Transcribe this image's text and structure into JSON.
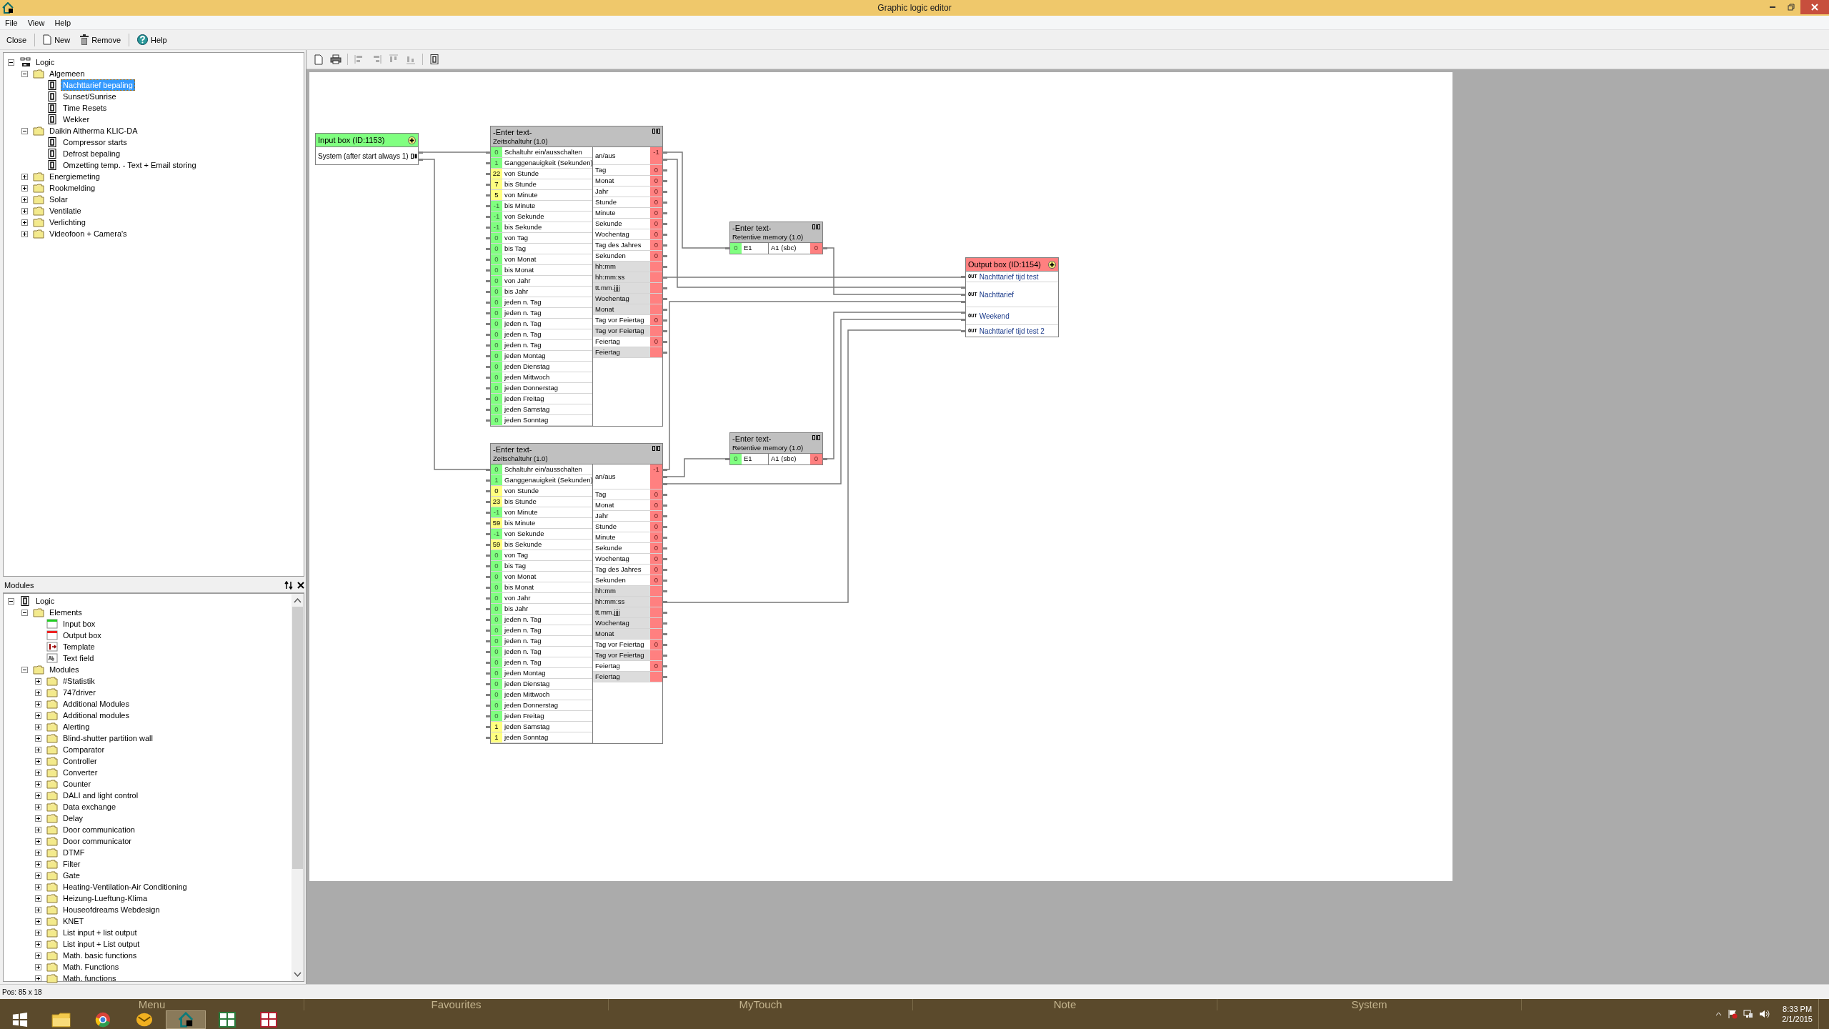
{
  "window": {
    "title": "Graphic logic editor"
  },
  "menu": [
    "File",
    "View",
    "Help"
  ],
  "toolbar": [
    {
      "label": "Close",
      "kind": "plain"
    },
    {
      "label": "New",
      "kind": "new"
    },
    {
      "label": "Remove",
      "kind": "trash"
    },
    {
      "label": "Help",
      "kind": "help"
    }
  ],
  "project_tree": [
    {
      "label": "Logic",
      "kind": "root",
      "expanded": true,
      "selected": false,
      "children": [
        {
          "label": "Algemeen",
          "kind": "folder",
          "expanded": true,
          "selected": false,
          "children": [
            {
              "label": "Nachttarief bepaling",
              "kind": "logic",
              "selected": true
            },
            {
              "label": "Sunset/Sunrise",
              "kind": "logic",
              "selected": false
            },
            {
              "label": "Time Resets",
              "kind": "logic",
              "selected": false
            },
            {
              "label": "Wekker",
              "kind": "logic",
              "selected": false
            }
          ]
        },
        {
          "label": "Daikin Altherma KLIC-DA",
          "kind": "folder",
          "expanded": true,
          "selected": false,
          "children": [
            {
              "label": "Compressor starts",
              "kind": "logic",
              "selected": false
            },
            {
              "label": "Defrost bepaling",
              "kind": "logic",
              "selected": false
            },
            {
              "label": "Omzetting temp. - Text + Email storing",
              "kind": "logic",
              "selected": false
            }
          ]
        },
        {
          "label": "Energiemeting",
          "kind": "folder",
          "expanded": false,
          "selected": false
        },
        {
          "label": "Rookmelding",
          "kind": "folder",
          "expanded": false,
          "selected": false
        },
        {
          "label": "Solar",
          "kind": "folder",
          "expanded": false,
          "selected": false
        },
        {
          "label": "Ventilatie",
          "kind": "folder",
          "expanded": false,
          "selected": false
        },
        {
          "label": "Verlichting",
          "kind": "folder",
          "expanded": false,
          "selected": false
        },
        {
          "label": "Videofoon + Camera's",
          "kind": "folder",
          "expanded": false,
          "selected": false
        }
      ]
    }
  ],
  "modules_panel": {
    "title": "Modules",
    "tree": [
      {
        "label": "Logic",
        "kind": "logic",
        "expanded": true,
        "selected": false,
        "children": [
          {
            "label": "Elements",
            "kind": "folder",
            "expanded": true,
            "selected": false,
            "children": [
              {
                "label": "Input box",
                "kind": "input",
                "selected": false
              },
              {
                "label": "Output box",
                "kind": "output",
                "selected": false
              },
              {
                "label": "Template",
                "kind": "template",
                "selected": false
              },
              {
                "label": "Text field",
                "kind": "textfield",
                "selected": false
              }
            ]
          },
          {
            "label": "Modules",
            "kind": "folder",
            "expanded": true,
            "selected": false,
            "children": [
              {
                "label": "#Statistik",
                "kind": "folder",
                "expanded": false,
                "selected": false
              },
              {
                "label": "747driver",
                "kind": "folder",
                "expanded": false,
                "selected": false
              },
              {
                "label": "Additional Modules",
                "kind": "folder",
                "expanded": false,
                "selected": false
              },
              {
                "label": "Additional modules",
                "kind": "folder",
                "expanded": false,
                "selected": false
              },
              {
                "label": "Alerting",
                "kind": "folder",
                "expanded": false,
                "selected": false
              },
              {
                "label": "Blind-shutter partition wall",
                "kind": "folder",
                "expanded": false,
                "selected": false
              },
              {
                "label": "Comparator",
                "kind": "folder",
                "expanded": false,
                "selected": false
              },
              {
                "label": "Controller",
                "kind": "folder",
                "expanded": false,
                "selected": false
              },
              {
                "label": "Converter",
                "kind": "folder",
                "expanded": false,
                "selected": false
              },
              {
                "label": "Counter",
                "kind": "folder",
                "expanded": false,
                "selected": false
              },
              {
                "label": "DALI and light control",
                "kind": "folder",
                "expanded": false,
                "selected": false
              },
              {
                "label": "Data exchange",
                "kind": "folder",
                "expanded": false,
                "selected": false
              },
              {
                "label": "Delay",
                "kind": "folder",
                "expanded": false,
                "selected": false
              },
              {
                "label": "Door communication",
                "kind": "folder",
                "expanded": false,
                "selected": false
              },
              {
                "label": "Door communicator",
                "kind": "folder",
                "expanded": false,
                "selected": false
              },
              {
                "label": "DTMF",
                "kind": "folder",
                "expanded": false,
                "selected": false
              },
              {
                "label": "Filter",
                "kind": "folder",
                "expanded": false,
                "selected": false
              },
              {
                "label": "Gate",
                "kind": "folder",
                "expanded": false,
                "selected": false
              },
              {
                "label": "Heating-Ventilation-Air Conditioning",
                "kind": "folder",
                "expanded": false,
                "selected": false
              },
              {
                "label": "Heizung-Lueftung-Klima",
                "kind": "folder",
                "expanded": false,
                "selected": false
              },
              {
                "label": "Houseofdreams Webdesign",
                "kind": "folder",
                "expanded": false,
                "selected": false
              },
              {
                "label": "KNET",
                "kind": "folder",
                "expanded": false,
                "selected": false
              },
              {
                "label": "List input + list output",
                "kind": "folder",
                "expanded": false,
                "selected": false
              },
              {
                "label": "List input + List output",
                "kind": "folder",
                "expanded": false,
                "selected": false
              },
              {
                "label": "Math. basic functions",
                "kind": "folder",
                "expanded": false,
                "selected": false
              },
              {
                "label": "Math. Functions",
                "kind": "folder",
                "expanded": false,
                "selected": false
              },
              {
                "label": "Math. functions",
                "kind": "folder",
                "expanded": false,
                "selected": false
              }
            ]
          }
        ]
      }
    ]
  },
  "canvas_toolbar": [
    {
      "kind": "new",
      "disabled": false
    },
    {
      "kind": "print",
      "disabled": false
    },
    {
      "kind": "align-left",
      "disabled": true
    },
    {
      "kind": "align-right",
      "disabled": true
    },
    {
      "kind": "align-top",
      "disabled": true
    },
    {
      "kind": "align-bottom",
      "disabled": true
    },
    {
      "kind": "module",
      "disabled": false
    }
  ],
  "canvas": {
    "nodes": [
      {
        "kind": "input",
        "title": "Input box (ID:1153)",
        "rows": [
          {
            "label": "System (after start always 1)"
          }
        ]
      },
      {
        "kind": "timer",
        "title": "-Enter text-",
        "subtitle": "Zeitschaltuhr (1.0)",
        "inputs": [
          {
            "value": "0",
            "port": "Schaltuhr ein/ausschalten",
            "set": false
          },
          {
            "value": "1",
            "port": "Ganggenauigkeit (Sekunden)",
            "set": false
          },
          {
            "value": "22",
            "port": "von Stunde",
            "set": true
          },
          {
            "value": "7",
            "port": "bis Stunde",
            "set": true
          },
          {
            "value": "5",
            "port": "von Minute",
            "set": true
          },
          {
            "value": "-1",
            "port": "bis Minute",
            "set": false
          },
          {
            "value": "-1",
            "port": "von Sekunde",
            "set": false
          },
          {
            "value": "-1",
            "port": "bis Sekunde",
            "set": false
          },
          {
            "value": "0",
            "port": "von Tag",
            "set": false
          },
          {
            "value": "0",
            "port": "bis Tag",
            "set": false
          },
          {
            "value": "0",
            "port": "von Monat",
            "set": false
          },
          {
            "value": "0",
            "port": "bis Monat",
            "set": false
          },
          {
            "value": "0",
            "port": "von Jahr",
            "set": false
          },
          {
            "value": "0",
            "port": "bis Jahr",
            "set": false
          },
          {
            "value": "0",
            "port": "jeden n. Tag",
            "set": false
          },
          {
            "value": "0",
            "port": "jeden n. Tag",
            "set": false
          },
          {
            "value": "0",
            "port": "jeden n. Tag",
            "set": false
          },
          {
            "value": "0",
            "port": "jeden n. Tag",
            "set": false
          },
          {
            "value": "0",
            "port": "jeden n. Tag",
            "set": false
          },
          {
            "value": "0",
            "port": "jeden Montag",
            "set": false
          },
          {
            "value": "0",
            "port": "jeden Dienstag",
            "set": false
          },
          {
            "value": "0",
            "port": "jeden Mittwoch",
            "set": false
          },
          {
            "value": "0",
            "port": "jeden Donnerstag",
            "set": false
          },
          {
            "value": "0",
            "port": "jeden Freitag",
            "set": false
          },
          {
            "value": "0",
            "port": "jeden Samstag",
            "set": false
          },
          {
            "value": "0",
            "port": "jeden Sonntag",
            "set": false
          }
        ],
        "outputs": [
          {
            "kind": "primary",
            "label": "an/aus",
            "value": "-1"
          },
          {
            "kind": "number",
            "label": "Tag",
            "value": "0"
          },
          {
            "kind": "number",
            "label": "Monat",
            "value": "0"
          },
          {
            "kind": "number",
            "label": "Jahr",
            "value": "0"
          },
          {
            "kind": "number",
            "label": "Stunde",
            "value": "0"
          },
          {
            "kind": "number",
            "label": "Minute",
            "value": "0"
          },
          {
            "kind": "number",
            "label": "Sekunde",
            "value": "0"
          },
          {
            "kind": "number",
            "label": "Wochentag",
            "value": "0"
          },
          {
            "kind": "number",
            "label": "Tag des Jahres",
            "value": "0"
          },
          {
            "kind": "number",
            "label": "Sekunden",
            "value": "0"
          },
          {
            "kind": "text",
            "label": "hh:mm"
          },
          {
            "kind": "text",
            "label": "hh:mm:ss"
          },
          {
            "kind": "text",
            "label": "tt.mm.jjjj"
          },
          {
            "kind": "text",
            "label": "Wochentag"
          },
          {
            "kind": "text",
            "label": "Monat"
          },
          {
            "kind": "number",
            "label": "Tag vor Feiertag",
            "value": "0"
          },
          {
            "kind": "text",
            "label": "Tag vor Feiertag"
          },
          {
            "kind": "number",
            "label": "Feiertag",
            "value": "0"
          },
          {
            "kind": "text",
            "label": "Feiertag"
          }
        ]
      },
      {
        "kind": "memory",
        "title": "-Enter text-",
        "subtitle": "Retentive memory (1.0)",
        "input": {
          "value": "0",
          "port": "E1"
        },
        "output": {
          "label": "A1 (sbc)",
          "value": "0"
        }
      },
      {
        "kind": "output",
        "title": "Output box (ID:1154)",
        "rows": [
          {
            "tag": "OUT",
            "label": "Nachttarief tijd test"
          },
          {
            "tag": "OUT",
            "label": "Nachttarief"
          },
          {
            "tag": "OUT",
            "label": "Weekend"
          },
          {
            "tag": "OUT",
            "label": "Nachttarief tijd test 2"
          }
        ]
      },
      {
        "kind": "timer",
        "title": "-Enter text-",
        "subtitle": "Zeitschaltuhr (1.0)",
        "inputs": [
          {
            "value": "0",
            "port": "Schaltuhr ein/ausschalten",
            "set": false
          },
          {
            "value": "1",
            "port": "Ganggenauigkeit (Sekunden)",
            "set": false
          },
          {
            "value": "0",
            "port": "von Stunde",
            "set": true
          },
          {
            "value": "23",
            "port": "bis Stunde",
            "set": true
          },
          {
            "value": "-1",
            "port": "von Minute",
            "set": false
          },
          {
            "value": "59",
            "port": "bis Minute",
            "set": true
          },
          {
            "value": "-1",
            "port": "von Sekunde",
            "set": false
          },
          {
            "value": "59",
            "port": "bis Sekunde",
            "set": true
          },
          {
            "value": "0",
            "port": "von Tag",
            "set": false
          },
          {
            "value": "0",
            "port": "bis Tag",
            "set": false
          },
          {
            "value": "0",
            "port": "von Monat",
            "set": false
          },
          {
            "value": "0",
            "port": "bis Monat",
            "set": false
          },
          {
            "value": "0",
            "port": "von Jahr",
            "set": false
          },
          {
            "value": "0",
            "port": "bis Jahr",
            "set": false
          },
          {
            "value": "0",
            "port": "jeden n. Tag",
            "set": false
          },
          {
            "value": "0",
            "port": "jeden n. Tag",
            "set": false
          },
          {
            "value": "0",
            "port": "jeden n. Tag",
            "set": false
          },
          {
            "value": "0",
            "port": "jeden n. Tag",
            "set": false
          },
          {
            "value": "0",
            "port": "jeden n. Tag",
            "set": false
          },
          {
            "value": "0",
            "port": "jeden Montag",
            "set": false
          },
          {
            "value": "0",
            "port": "jeden Dienstag",
            "set": false
          },
          {
            "value": "0",
            "port": "jeden Mittwoch",
            "set": false
          },
          {
            "value": "0",
            "port": "jeden Donnerstag",
            "set": false
          },
          {
            "value": "0",
            "port": "jeden Freitag",
            "set": false
          },
          {
            "value": "1",
            "port": "jeden Samstag",
            "set": true
          },
          {
            "value": "1",
            "port": "jeden Sonntag",
            "set": true
          }
        ],
        "outputs": [
          {
            "kind": "primary",
            "label": "an/aus",
            "value": "-1"
          },
          {
            "kind": "number",
            "label": "Tag",
            "value": "0"
          },
          {
            "kind": "number",
            "label": "Monat",
            "value": "0"
          },
          {
            "kind": "number",
            "label": "Jahr",
            "value": "0"
          },
          {
            "kind": "number",
            "label": "Stunde",
            "value": "0"
          },
          {
            "kind": "number",
            "label": "Minute",
            "value": "0"
          },
          {
            "kind": "number",
            "label": "Sekunde",
            "value": "0"
          },
          {
            "kind": "number",
            "label": "Wochentag",
            "value": "0"
          },
          {
            "kind": "number",
            "label": "Tag des Jahres",
            "value": "0"
          },
          {
            "kind": "number",
            "label": "Sekunden",
            "value": "0"
          },
          {
            "kind": "text",
            "label": "hh:mm"
          },
          {
            "kind": "text",
            "label": "hh:mm:ss"
          },
          {
            "kind": "text",
            "label": "tt.mm.jjjj"
          },
          {
            "kind": "text",
            "label": "Wochentag"
          },
          {
            "kind": "text",
            "label": "Monat"
          },
          {
            "kind": "number",
            "label": "Tag vor Feiertag",
            "value": "0"
          },
          {
            "kind": "text",
            "label": "Tag vor Feiertag"
          },
          {
            "kind": "number",
            "label": "Feiertag",
            "value": "0"
          },
          {
            "kind": "text",
            "label": "Feiertag"
          }
        ]
      },
      {
        "kind": "memory",
        "title": "-Enter text-",
        "subtitle": "Retentive memory (1.0)",
        "input": {
          "value": "0",
          "port": "E1"
        },
        "output": {
          "label": "A1 (sbc)",
          "value": "0"
        }
      }
    ]
  },
  "status_bar": "Pos: 85 x 18",
  "taskbar": {
    "app_bar": [
      "Menu",
      "Favourites",
      "MyTouch",
      "Note",
      "System"
    ],
    "apps": [
      {
        "kind": "start",
        "selected": false
      },
      {
        "kind": "folder",
        "selected": false
      },
      {
        "kind": "browser",
        "selected": false
      },
      {
        "kind": "mail",
        "selected": false
      },
      {
        "kind": "house",
        "selected": true
      },
      {
        "kind": "layout",
        "selected": false
      },
      {
        "kind": "layout-red",
        "selected": false
      }
    ],
    "time": "8:33 PM",
    "date": "2/1/2015"
  }
}
